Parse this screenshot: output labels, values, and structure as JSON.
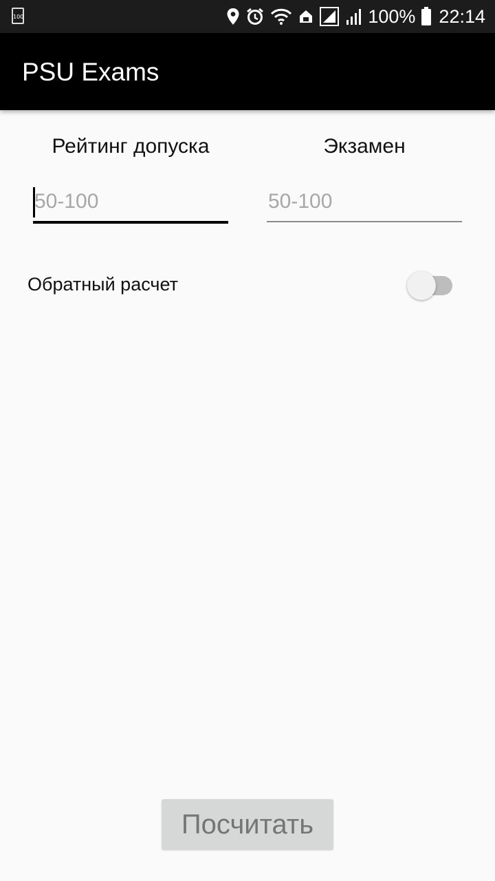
{
  "status_bar": {
    "notification_icon_text": "100",
    "battery_percent": "100%",
    "time": "22:14",
    "icons": [
      "location-icon",
      "alarm-icon",
      "wifi-icon",
      "home-icon",
      "signal-icon",
      "signal-2-icon",
      "battery-icon"
    ]
  },
  "app_bar": {
    "title": "PSU Exams"
  },
  "form": {
    "rating_label": "Рейтинг допуска",
    "exam_label": "Экзамен",
    "rating_placeholder": "50-100",
    "exam_placeholder": "50-100",
    "rating_value": "",
    "exam_value": "",
    "reverse_label": "Обратный расчет",
    "reverse_enabled": false,
    "calculate_label": "Посчитать"
  },
  "colors": {
    "app_bar": "#000000",
    "background": "#fafafa",
    "button_bg": "#d6d7d7",
    "button_text": "#757575",
    "placeholder": "#a7a7a7"
  }
}
